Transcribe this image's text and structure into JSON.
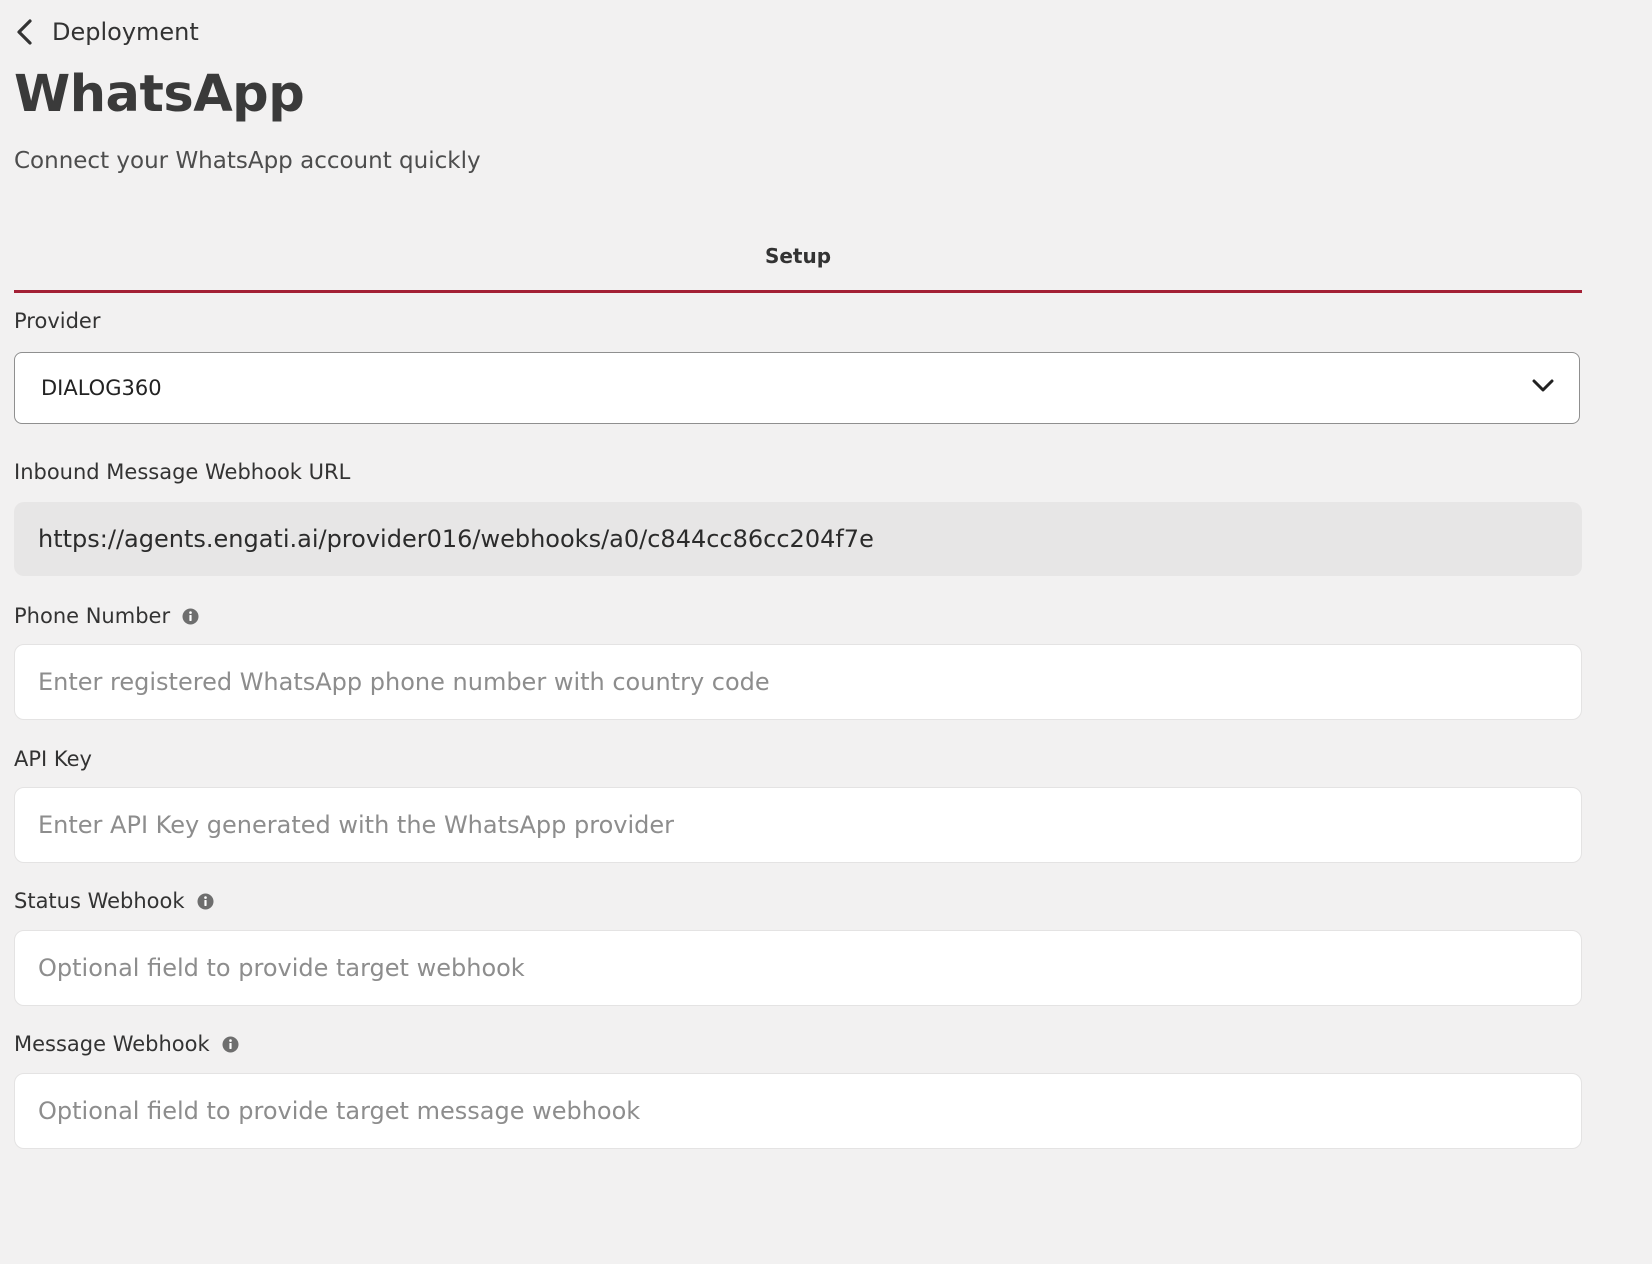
{
  "header": {
    "back_label": "Deployment",
    "title": "WhatsApp",
    "subtitle": "Connect your WhatsApp account quickly"
  },
  "tabs": [
    {
      "label": "Setup",
      "active": true
    }
  ],
  "form": {
    "provider": {
      "label": "Provider",
      "value": "DIALOG360"
    },
    "inbound_webhook": {
      "label": "Inbound Message Webhook URL",
      "value": "https://agents.engati.ai/provider016/webhooks/a0/c844cc86cc204f7e"
    },
    "phone_number": {
      "label": "Phone Number",
      "placeholder": "Enter registered WhatsApp phone number with country code"
    },
    "api_key": {
      "label": "API Key",
      "placeholder": "Enter API Key generated with the WhatsApp provider"
    },
    "status_webhook": {
      "label": "Status Webhook",
      "placeholder": "Optional field to provide target webhook"
    },
    "message_webhook": {
      "label": "Message Webhook",
      "placeholder": "Optional field to provide target message webhook"
    }
  },
  "colors": {
    "background": "#f2f1f1",
    "accent": "#a32035",
    "readonly_fill": "#e7e6e6",
    "text": "#333333",
    "placeholder": "#8d8d8d"
  },
  "icons": {
    "back": "chevron-left-icon",
    "dropdown": "chevron-down-icon",
    "info": "info-icon"
  }
}
